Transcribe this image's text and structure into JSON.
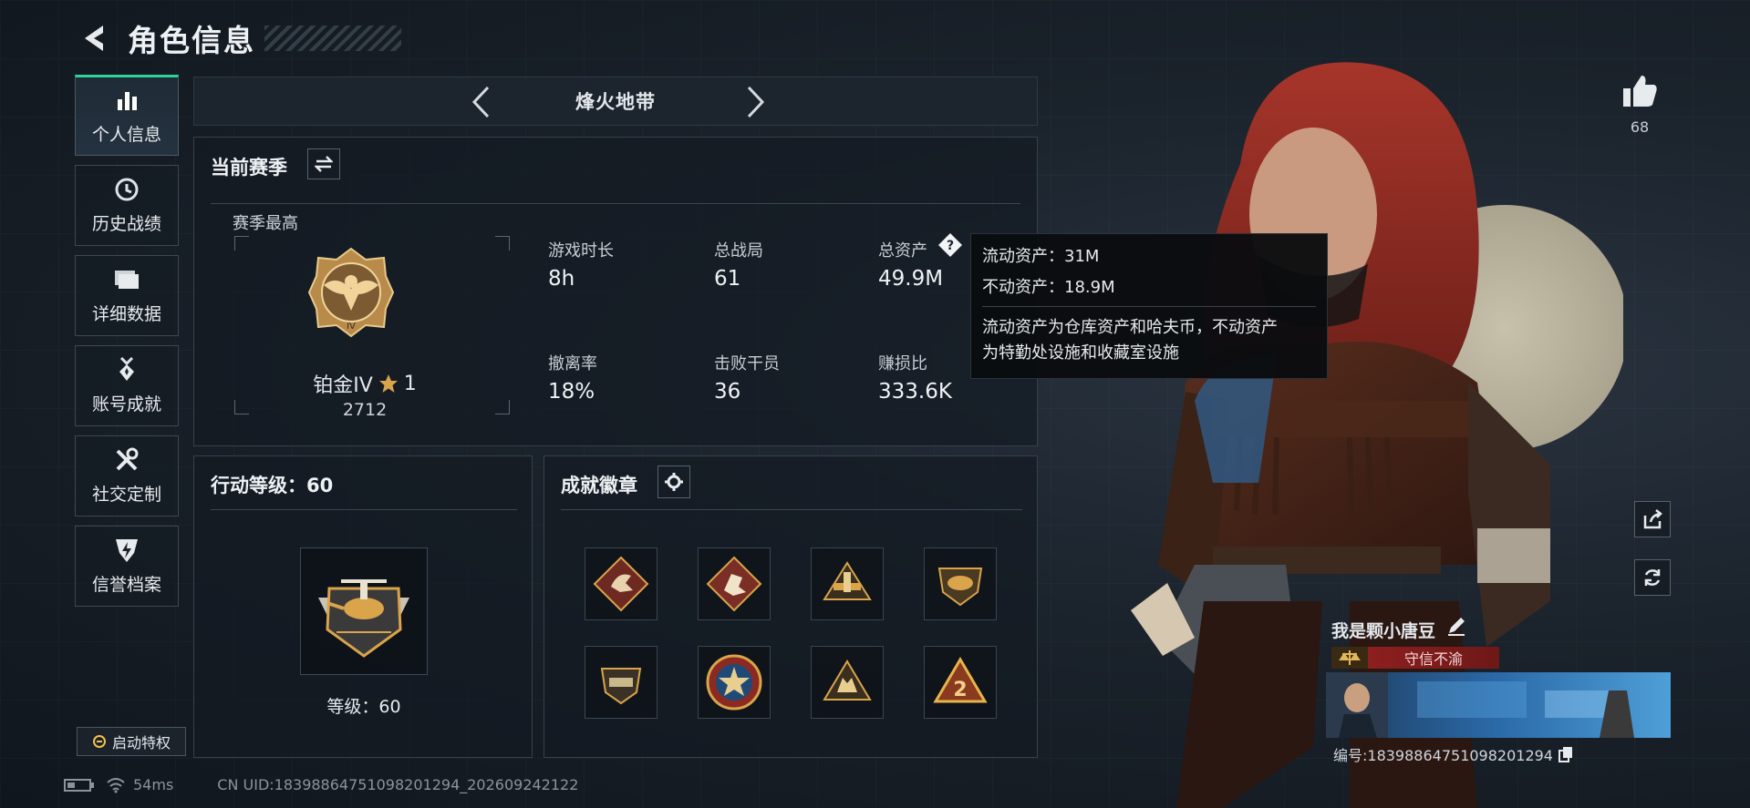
{
  "header": {
    "title": "角色信息"
  },
  "sidebar": {
    "items": [
      {
        "label": "个人信息"
      },
      {
        "label": "历史战绩"
      },
      {
        "label": "详细数据"
      },
      {
        "label": "账号成就"
      },
      {
        "label": "社交定制"
      },
      {
        "label": "信誉档案"
      }
    ],
    "launch_label": "启动特权"
  },
  "mode": {
    "title": "烽火地带"
  },
  "season": {
    "title": "当前赛季",
    "best_label": "赛季最高",
    "rank_name": "铂金IV",
    "rank_stars": "1",
    "rank_points": "2712",
    "stats": [
      {
        "label": "游戏时长",
        "value": "8h"
      },
      {
        "label": "总战局",
        "value": "61"
      },
      {
        "label": "总资产",
        "value": "49.9M"
      },
      {
        "label": "撤离率",
        "value": "18%"
      },
      {
        "label": "击败干员",
        "value": "36"
      },
      {
        "label": "赚损比",
        "value": "333.6K"
      }
    ]
  },
  "tooltip": {
    "liquid": "流动资产：31M",
    "fixed": "不动资产：18.9M",
    "desc_line1": "流动资产为仓库资产和哈夫币，不动资产",
    "desc_line2": "为特勤处设施和收藏室设施"
  },
  "action_level": {
    "title": "行动等级：60",
    "level_text": "等级：60"
  },
  "achievements": {
    "title": "成就徽章",
    "badges": [
      "dragon-badge-icon",
      "hand-badge-icon",
      "tower-badge-icon",
      "shield-badge-icon",
      "crest-badge-icon",
      "star-badge-icon",
      "beast-badge-icon",
      "number-two-badge-icon"
    ]
  },
  "profile": {
    "likes": "68",
    "player_name": "我是颗小唐豆",
    "reputation": "守信不渝",
    "player_id": "编号:1839886475109820​1294"
  },
  "status": {
    "ping": "54ms",
    "uid": "CN UID:1839886475109820​1294_202609242122"
  },
  "colors": {
    "accent": "#2fd39a",
    "gold": "#d9a44a",
    "reputation": "#8d1f1f"
  }
}
